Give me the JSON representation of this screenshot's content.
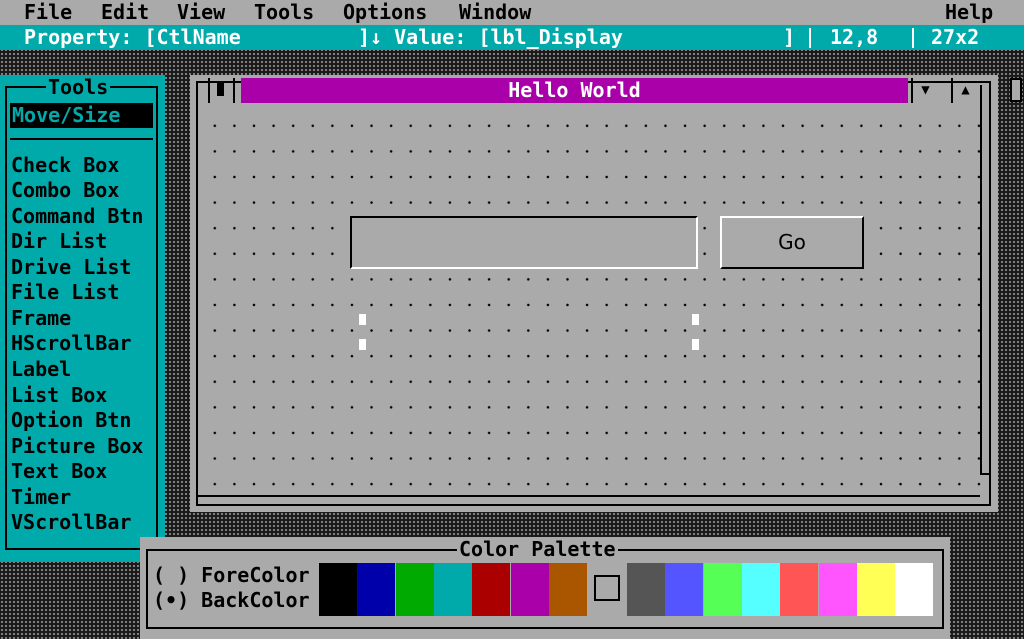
{
  "menu": {
    "items": [
      "File",
      "Edit",
      "View",
      "Tools",
      "Options",
      "Window"
    ],
    "help": "Help"
  },
  "propbar": {
    "property": "Property: [CtlName",
    "value": "]↓ Value: [lbl_Display",
    "close": "]",
    "position": "12,8",
    "size": "27x2"
  },
  "tools": {
    "title": "Tools",
    "selected": "Move/Size",
    "items": [
      "Check Box",
      "Combo Box",
      "Command Btn",
      "Dir List",
      "Drive List",
      "File List",
      "Frame",
      "HScrollBar",
      "Label",
      "List Box",
      "Option Btn",
      "Picture Box",
      "Text Box",
      "Timer",
      "VScrollBar"
    ]
  },
  "form": {
    "title": "Hello World",
    "button_label": "Go",
    "min_glyph": "▼",
    "max_glyph": "▲"
  },
  "palette": {
    "title": "Color Palette",
    "fore_option": "( ) ForeColor",
    "back_option": "(•) BackColor",
    "colors": [
      "#000000",
      "#0000aa",
      "#00aa00",
      "#00aaaa",
      "#aa0000",
      "#aa00aa",
      "#aa5500",
      "#555555",
      "#5555ff",
      "#55ff55",
      "#55ffff",
      "#ff5555",
      "#ff55ff",
      "#ffff55",
      "#ffffff"
    ]
  }
}
